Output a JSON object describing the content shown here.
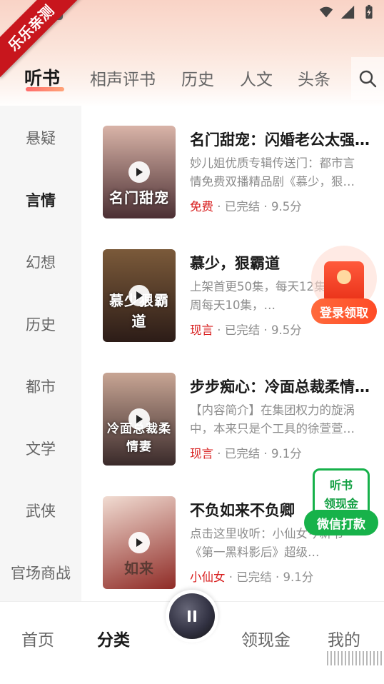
{
  "ribbon": "乐乐亲测",
  "top_tabs": [
    "听书",
    "相声评书",
    "历史",
    "人文",
    "头条"
  ],
  "sidebar": [
    "悬疑",
    "言情",
    "幻想",
    "历史",
    "都市",
    "文学",
    "武侠",
    "官场商战"
  ],
  "sidebar_active_index": 1,
  "books": [
    {
      "title": "名门甜宠：闪婚老公太强…",
      "desc": "妙儿姐优质专辑传送门：都市言情免费双播精品剧《慕少，狠…",
      "tag": "免费",
      "meta": " · 已完结 · 9.5分",
      "cover_text": "名门甜宠",
      "cover_colors": [
        "#d9b4a8",
        "#4b2f33"
      ]
    },
    {
      "title": "慕少，狠霸道",
      "desc": "上架首更50集，每天12集，第一周每天10集，…",
      "tag": "现言",
      "meta": " · 已完结 · 9.5分",
      "cover_text": "慕少狠霸道",
      "cover_colors": [
        "#7b5a3a",
        "#2c1c17"
      ]
    },
    {
      "title": "步步痴心：冷面总裁柔情…",
      "desc": "【内容简介】在集团权力的旋涡中，本来只是个工具的徐萱萱…",
      "tag": "现言",
      "meta": " · 已完结 · 9.1分",
      "cover_text": "冷面总裁柔情妻",
      "cover_colors": [
        "#c8a594",
        "#3a2a2a"
      ]
    },
    {
      "title": "不负如来不负卿",
      "desc": "点击这里收听：小仙女今新书《第一黑料影后》超级…",
      "tag": "小仙女",
      "meta": " · 已完结 · 9.1分",
      "cover_text": "如来",
      "cover_colors": [
        "#f1dcd2",
        "#8f2b26"
      ]
    }
  ],
  "float_redpack": {
    "label": "登录领取"
  },
  "float_cash": {
    "line1": "听书",
    "line2": "领现金",
    "button": "微信打款"
  },
  "bottom_nav": [
    "首页",
    "分类",
    "领现金",
    "我的"
  ],
  "bottom_nav_active_index": 1
}
